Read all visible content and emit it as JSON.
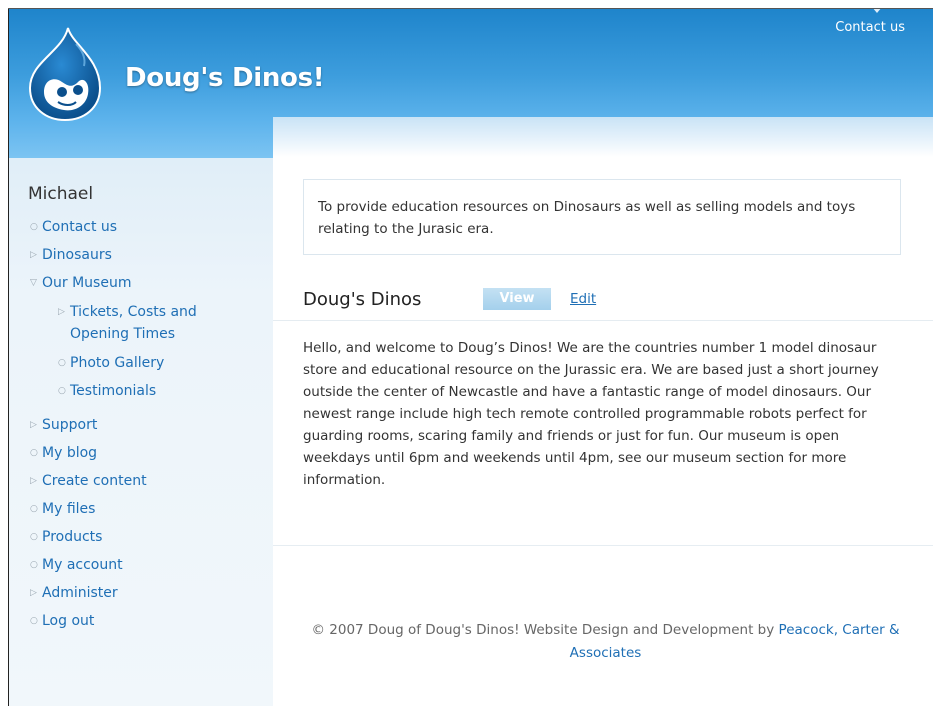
{
  "header": {
    "site_name": "Doug's Dinos!",
    "top_link": "Contact us",
    "logo_icon": "drupal-drop-icon"
  },
  "sidebar": {
    "user_name": "Michael",
    "items": [
      {
        "label": "Contact us",
        "marker": "○"
      },
      {
        "label": "Dinosaurs",
        "marker": "▷"
      },
      {
        "label": "Our Museum",
        "marker": "▽"
      },
      {
        "label": "Tickets, Costs and Opening Times",
        "marker": "▷"
      },
      {
        "label": "Photo Gallery",
        "marker": "○"
      },
      {
        "label": "Testimonials",
        "marker": "○"
      },
      {
        "label": "Support",
        "marker": "▷"
      },
      {
        "label": "My blog",
        "marker": "○"
      },
      {
        "label": "Create content",
        "marker": "▷"
      },
      {
        "label": "My files",
        "marker": "○"
      },
      {
        "label": "Products",
        "marker": "○"
      },
      {
        "label": "My account",
        "marker": "○"
      },
      {
        "label": "Administer",
        "marker": "▷"
      },
      {
        "label": "Log out",
        "marker": "○"
      }
    ]
  },
  "content": {
    "mission": "To provide education resources on Dinosaurs as well as selling models and toys relating to the Jurasic era.",
    "node_title": "Doug's Dinos",
    "tabs": {
      "view": "View",
      "edit": "Edit"
    },
    "body": "Hello, and welcome to Doug’s Dinos! We are the countries number 1 model dinosaur store and educational resource on the Jurassic era. We are based just a short journey outside the center of Newcastle and have a fantastic range of model dinosaurs. Our newest range include high tech remote controlled programmable robots perfect for guarding rooms, scaring family and friends or just for fun. Our museum is open weekdays until 6pm and weekends until 4pm, see our museum section for more information."
  },
  "footer": {
    "text": "© 2007 Doug of Doug's Dinos! Website Design and Development by",
    "link": "Peacock, Carter & Associates"
  }
}
